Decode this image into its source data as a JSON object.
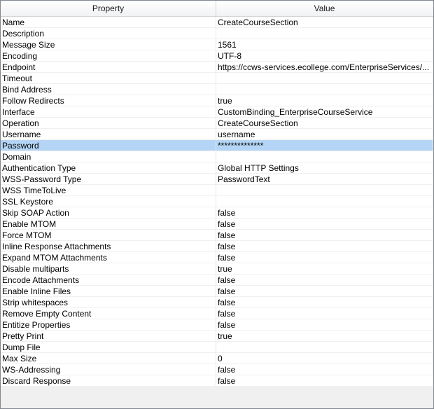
{
  "header": {
    "property": "Property",
    "value": "Value"
  },
  "rows": [
    {
      "k": "Name",
      "v": "CreateCourseSection"
    },
    {
      "k": "Description",
      "v": ""
    },
    {
      "k": "Message Size",
      "v": "1561"
    },
    {
      "k": "Encoding",
      "v": "UTF-8"
    },
    {
      "k": "Endpoint",
      "v": "https://ccws-services.ecollege.com/EnterpriseServices/..."
    },
    {
      "k": "Timeout",
      "v": ""
    },
    {
      "k": "Bind Address",
      "v": ""
    },
    {
      "k": "Follow Redirects",
      "v": "true"
    },
    {
      "k": "Interface",
      "v": "CustomBinding_EnterpriseCourseService"
    },
    {
      "k": "Operation",
      "v": "CreateCourseSection"
    },
    {
      "k": "Username",
      "v": "username"
    },
    {
      "k": "Password",
      "v": "**************",
      "selected": true
    },
    {
      "k": "Domain",
      "v": ""
    },
    {
      "k": "Authentication Type",
      "v": "Global HTTP Settings"
    },
    {
      "k": "WSS-Password Type",
      "v": "PasswordText"
    },
    {
      "k": "WSS TimeToLive",
      "v": ""
    },
    {
      "k": "SSL Keystore",
      "v": ""
    },
    {
      "k": "Skip SOAP Action",
      "v": "false"
    },
    {
      "k": "Enable MTOM",
      "v": "false"
    },
    {
      "k": "Force MTOM",
      "v": "false"
    },
    {
      "k": "Inline Response Attachments",
      "v": "false"
    },
    {
      "k": "Expand MTOM Attachments",
      "v": "false"
    },
    {
      "k": "Disable multiparts",
      "v": "true"
    },
    {
      "k": "Encode Attachments",
      "v": "false"
    },
    {
      "k": "Enable Inline Files",
      "v": "false"
    },
    {
      "k": "Strip whitespaces",
      "v": "false"
    },
    {
      "k": "Remove Empty Content",
      "v": "false"
    },
    {
      "k": "Entitize Properties",
      "v": "false"
    },
    {
      "k": "Pretty Print",
      "v": "true"
    },
    {
      "k": "Dump File",
      "v": ""
    },
    {
      "k": "Max Size",
      "v": "0"
    },
    {
      "k": "WS-Addressing",
      "v": "false"
    },
    {
      "k": "Discard Response",
      "v": "false"
    }
  ]
}
